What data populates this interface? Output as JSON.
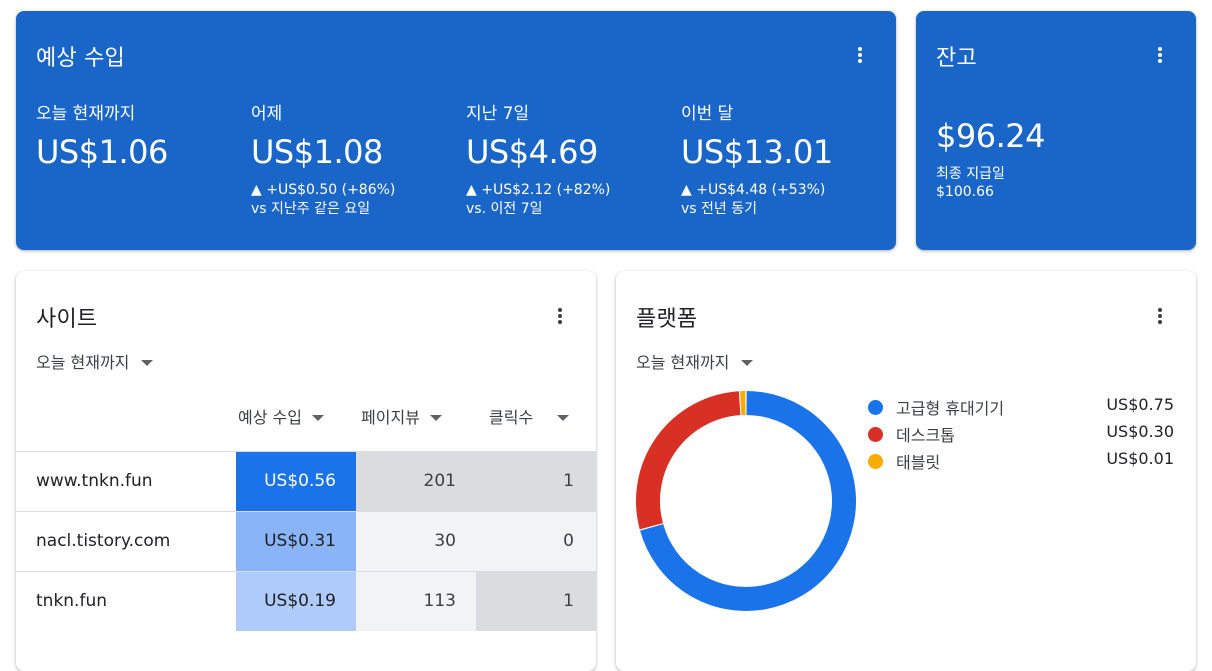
{
  "earnings": {
    "title": "예상 수입",
    "stats": [
      {
        "label": "오늘 현재까지",
        "value": "US$1.06",
        "change": "",
        "compare": ""
      },
      {
        "label": "어제",
        "value": "US$1.08",
        "change": "▲ +US$0.50 (+86%)",
        "compare": "vs 지난주 같은 요일"
      },
      {
        "label": "지난 7일",
        "value": "US$4.69",
        "change": "▲ +US$2.12 (+82%)",
        "compare": "vs. 이전 7일"
      },
      {
        "label": "이번 달",
        "value": "US$13.01",
        "change": "▲ +US$4.48 (+53%)",
        "compare": "vs 전년 동기"
      }
    ]
  },
  "balance": {
    "title": "잔고",
    "value": "$96.24",
    "last_payment_label": "최종 지급일",
    "last_payment_value": "$100.66"
  },
  "sites": {
    "title": "사이트",
    "period": "오늘 현재까지",
    "columns": [
      "예상 수입",
      "페이지뷰",
      "클릭수"
    ],
    "rows": [
      {
        "site": "www.tnkn.fun",
        "revenue": "US$0.56",
        "pageviews": "201",
        "clicks": "1"
      },
      {
        "site": "nacl.tistory.com",
        "revenue": "US$0.31",
        "pageviews": "30",
        "clicks": "0"
      },
      {
        "site": "tnkn.fun",
        "revenue": "US$0.19",
        "pageviews": "113",
        "clicks": "1"
      }
    ],
    "heat_colors": {
      "rev": [
        "#1a73e8",
        "#8ab4f8",
        "#aecbfa"
      ],
      "rev_text": [
        "#ffffff",
        "#202124",
        "#202124"
      ],
      "pv": [
        "#dadce0",
        "#f1f3f4",
        "#f1f3f4"
      ],
      "clk": [
        "#dadce0",
        "#f1f3f4",
        "#dadce0"
      ]
    }
  },
  "platform": {
    "title": "플랫폼",
    "period": "오늘 현재까지",
    "legend": [
      {
        "name": "고급형 휴대기기",
        "value": "US$0.75",
        "color": "#1a73e8"
      },
      {
        "name": "데스크톱",
        "value": "US$0.30",
        "color": "#d93025"
      },
      {
        "name": "태블릿",
        "value": "US$0.01",
        "color": "#f9ab00"
      }
    ]
  },
  "chart_data": {
    "type": "pie",
    "categories": [
      "고급형 휴대기기",
      "데스크톱",
      "태블릿"
    ],
    "values": [
      0.75,
      0.3,
      0.01
    ],
    "colors": [
      "#1a73e8",
      "#d93025",
      "#f9ab00"
    ],
    "title": "",
    "legend": "right"
  }
}
